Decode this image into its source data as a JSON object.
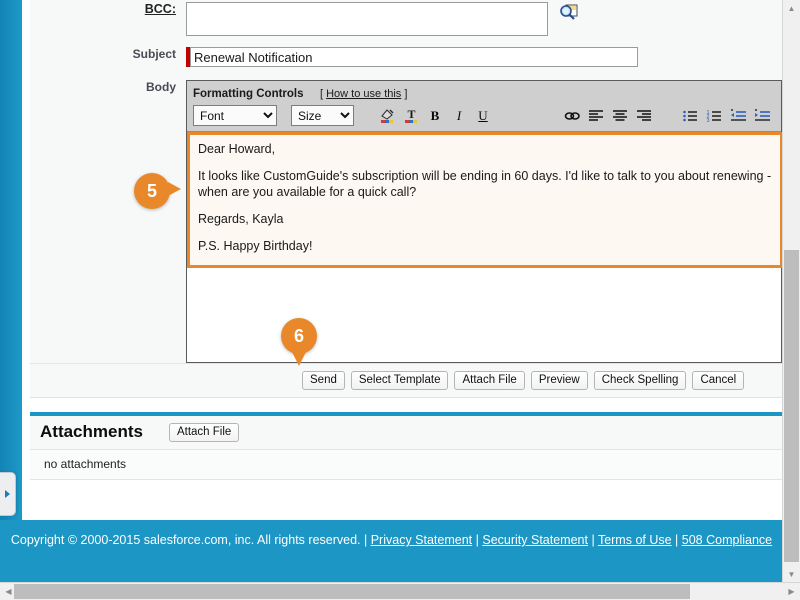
{
  "form": {
    "bcc_label": "BCC:",
    "bcc_value": "",
    "lookup_icon": "search-lookup-icon",
    "subject_label": "Subject",
    "subject_value": "Renewal Notification",
    "body_label": "Body"
  },
  "editor": {
    "toolbar_title": "Formatting Controls",
    "howto_prefix": "[ ",
    "howto_link": "How to use this",
    "howto_suffix": " ]",
    "font_select": "Font",
    "size_select": "Size",
    "buttons": [
      {
        "name": "background-color-icon",
        "glyph": "A"
      },
      {
        "name": "font-color-icon",
        "glyph": "T"
      },
      {
        "name": "bold-icon",
        "glyph": "B"
      },
      {
        "name": "italic-icon",
        "glyph": "I"
      },
      {
        "name": "underline-icon",
        "glyph": "U"
      },
      {
        "name": "insert-link-icon",
        "glyph": "∞"
      },
      {
        "name": "align-left-icon",
        "glyph": "≡"
      },
      {
        "name": "align-center-icon",
        "glyph": "≡"
      },
      {
        "name": "align-right-icon",
        "glyph": "≡"
      },
      {
        "name": "bulleted-list-icon",
        "glyph": "•≡"
      },
      {
        "name": "numbered-list-icon",
        "glyph": "1≡"
      },
      {
        "name": "decrease-indent-icon",
        "glyph": "←≡"
      },
      {
        "name": "increase-indent-icon",
        "glyph": "→≡"
      }
    ]
  },
  "body_text": {
    "paragraphs": [
      "Dear Howard,",
      "It looks like CustomGuide's subscription will be ending in 60 days. I'd like to talk to you about renewing - when are you available for a quick call?",
      "Regards, Kayla",
      "P.S. Happy Birthday!"
    ]
  },
  "actions": {
    "send": "Send",
    "select_template": "Select Template",
    "attach_file": "Attach File",
    "preview": "Preview",
    "check_spelling": "Check Spelling",
    "cancel": "Cancel"
  },
  "attachments": {
    "title": "Attachments",
    "attach_file_button": "Attach File",
    "empty_text": "no attachments"
  },
  "footer": {
    "copyright": "Copyright © 2000-2015 salesforce.com, inc. All rights reserved. | ",
    "privacy": "Privacy Statement",
    "sep1": " | ",
    "security": "Security Statement",
    "sep2": " | ",
    "terms": "Terms of Use",
    "sep3": " | ",
    "compliance": "508 Compliance"
  },
  "callouts": [
    {
      "number": "5"
    },
    {
      "number": "6"
    }
  ],
  "colors": {
    "brand_blue": "#1c96c5",
    "callout_orange": "#e8882a",
    "required_red": "#c00000",
    "highlight_bg": "#fdf8f1"
  }
}
